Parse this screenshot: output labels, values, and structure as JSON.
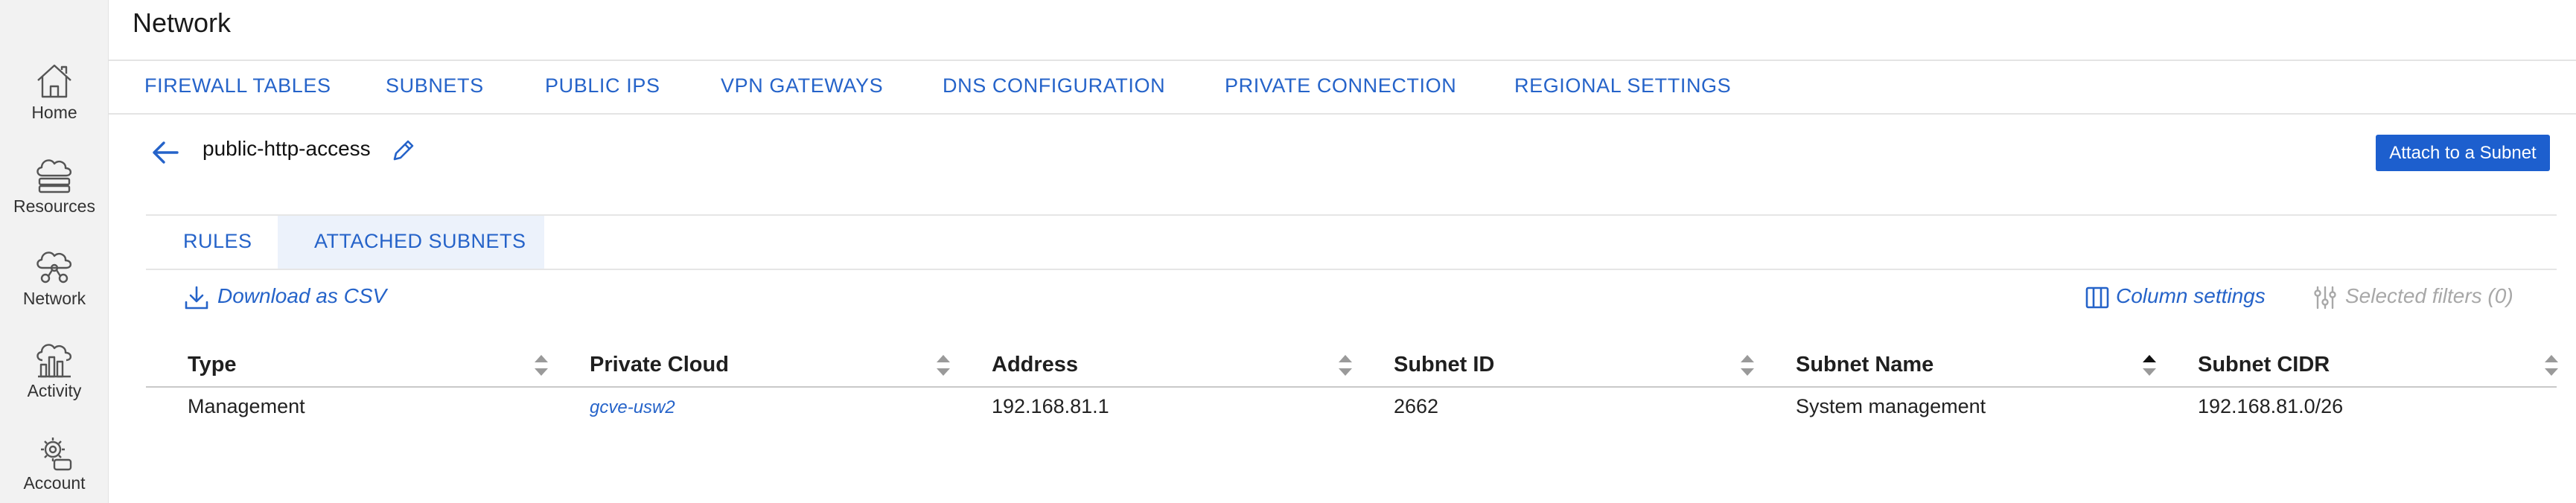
{
  "sidebar": {
    "items": [
      {
        "label": "Home",
        "icon": "home-icon"
      },
      {
        "label": "Resources",
        "icon": "cloud-stack-icon"
      },
      {
        "label": "Network",
        "icon": "cloud-network-icon"
      },
      {
        "label": "Activity",
        "icon": "activity-chart-icon"
      },
      {
        "label": "Account",
        "icon": "account-gear-icon"
      }
    ]
  },
  "header": {
    "title": "Network",
    "tabs": [
      {
        "label": "FIREWALL TABLES"
      },
      {
        "label": "SUBNETS"
      },
      {
        "label": "PUBLIC IPS"
      },
      {
        "label": "VPN GATEWAYS"
      },
      {
        "label": "DNS CONFIGURATION"
      },
      {
        "label": "PRIVATE CONNECTION"
      },
      {
        "label": "REGIONAL SETTINGS"
      }
    ]
  },
  "detail": {
    "name": "public-http-access",
    "attach_button": "Attach to a Subnet"
  },
  "subtabs": [
    {
      "label": "RULES",
      "active": false
    },
    {
      "label": "ATTACHED SUBNETS",
      "active": true
    }
  ],
  "toolbar": {
    "download": "Download as CSV",
    "column_settings": "Column settings",
    "selected_filters": "Selected filters (0)"
  },
  "table": {
    "columns": [
      {
        "label": "Type",
        "sort": "none"
      },
      {
        "label": "Private Cloud",
        "sort": "none"
      },
      {
        "label": "Address",
        "sort": "none"
      },
      {
        "label": "Subnet ID",
        "sort": "none"
      },
      {
        "label": "Subnet Name",
        "sort": "ascending"
      },
      {
        "label": "Subnet CIDR",
        "sort": "none"
      }
    ],
    "rows": [
      {
        "type": "Management",
        "private_cloud": "gcve-usw2",
        "address": "192.168.81.1",
        "subnet_id": "2662",
        "subnet_name": "System management",
        "subnet_cidr": "192.168.81.0/26"
      }
    ]
  },
  "colors": {
    "accent": "#2563c9",
    "button": "#1d5fce",
    "sidebar_bg": "#f2f2f2",
    "active_tab_bg": "#ecf2fb",
    "disabled": "#a8a8a8"
  }
}
